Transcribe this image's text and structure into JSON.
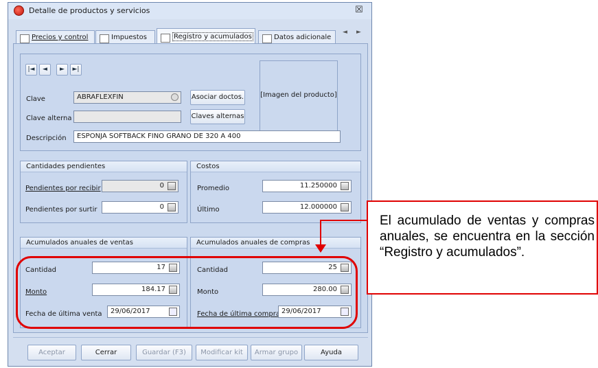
{
  "window": {
    "title": "Detalle de productos y servicios",
    "close_glyph": "☒",
    "tabs": [
      {
        "label": "Precios y control",
        "icon": "price-tag-icon"
      },
      {
        "label": "Impuestos",
        "icon": "tax-icon"
      },
      {
        "label": "Registro y acumulados",
        "icon": "register-icon",
        "active": true
      },
      {
        "label": "Datos adicionale",
        "icon": "data-icon"
      }
    ],
    "tab_scroll": {
      "left": "◄",
      "right": "►"
    }
  },
  "nav": {
    "first": "|◄",
    "prev": "◄",
    "next": "►",
    "last": "►|"
  },
  "fields": {
    "clave_label": "Clave",
    "clave_value": "ABRAFLEXFIN",
    "clave_alterna_label": "Clave alterna",
    "clave_alterna_value": "",
    "descripcion_label": "Descripción",
    "descripcion_value": "ESPONJA SOFTBACK FINO GRANO DE 320 A 400",
    "asociar_btn": "Asociar doctos.",
    "claves_btn": "Claves alternas",
    "image_placeholder": "[Imagen del producto]"
  },
  "pendientes": {
    "title": "Cantidades pendientes",
    "recibir_label": "Pendientes por recibir",
    "recibir_value": "0",
    "surtir_label": "Pendientes por surtir",
    "surtir_value": "0"
  },
  "costos": {
    "title": "Costos",
    "promedio_label": "Promedio",
    "promedio_value": "11.250000",
    "ultimo_label": "Último",
    "ultimo_value": "12.000000"
  },
  "ventas": {
    "title": "Acumulados anuales de ventas",
    "cantidad_label": "Cantidad",
    "cantidad_value": "17",
    "monto_label": "Monto",
    "monto_value": "184.17",
    "fecha_label": "Fecha de última venta",
    "fecha_value": "29/06/2017"
  },
  "compras": {
    "title": "Acumulados anuales de compras",
    "cantidad_label": "Cantidad",
    "cantidad_value": "25",
    "monto_label": "Monto",
    "monto_value": "280.00",
    "fecha_label": "Fecha de última compra",
    "fecha_value": "29/06/2017"
  },
  "buttons": {
    "aceptar": "Aceptar",
    "cerrar": "Cerrar",
    "guardar": "Guardar (F3)",
    "modificar": "Modificar kit",
    "armar": "Armar grupo",
    "ayuda": "Ayuda"
  },
  "callout": {
    "text": "El acumulado de ventas y compras anuales, se encuentra en la sección “Registro y acumulados”."
  },
  "colors": {
    "highlight": "#e00000",
    "window_bg": "#d4dff0"
  }
}
